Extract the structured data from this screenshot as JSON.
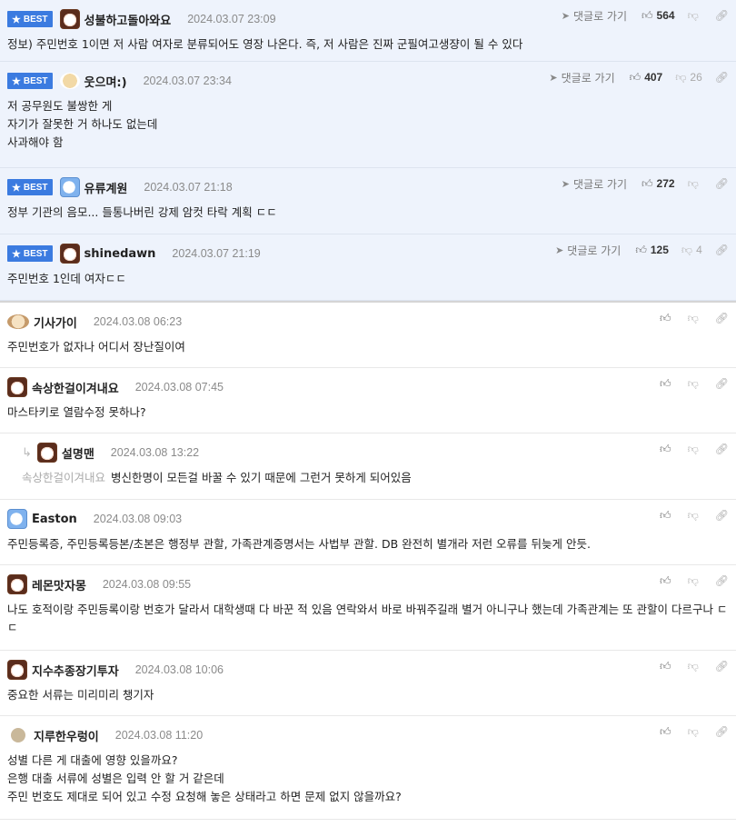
{
  "labels": {
    "best": "BEST",
    "reply_link": "댓글로 가기"
  },
  "comments": [
    {
      "nick": "성불하고돌아와요",
      "date": "2024.03.07 23:09",
      "up": "564",
      "down": "",
      "text": "정보) 주민번호 1이면 저 사람 여자로 분류되어도 영장 나온다. 즉, 저 사람은 진짜 군필여고생쟝이 될 수 있다"
    },
    {
      "nick": "웃으며:)",
      "date": "2024.03.07 23:34",
      "up": "407",
      "down": "26",
      "text": "저 공무원도 불쌍한 게\n자기가 잘못한 거 하나도 없는데\n사과해야 함"
    },
    {
      "nick": "유류계원",
      "date": "2024.03.07 21:18",
      "up": "272",
      "down": "",
      "text": "정부 기관의 음모... 들통나버린 강제 암컷 타락 계획 ㄷㄷ"
    },
    {
      "nick": "shinedawn",
      "date": "2024.03.07 21:19",
      "up": "125",
      "down": "4",
      "text": "주민번호 1인데 여자ㄷㄷ"
    },
    {
      "nick": "기사가이",
      "date": "2024.03.08 06:23",
      "text": "주민번호가 없자나 어디서 장난질이여"
    },
    {
      "nick": "속상한걸이겨내요",
      "date": "2024.03.08 07:45",
      "text": "마스타키로 열람수정 못하나?"
    },
    {
      "nick": "설명맨",
      "date": "2024.03.08 13:22",
      "mention": "속상한걸이겨내요",
      "text": "병신한명이 모든걸 바꿀 수 있기 때문에 그런거 못하게 되어있음"
    },
    {
      "nick": "Easton",
      "date": "2024.03.08 09:03",
      "text": "주민등록증, 주민등록등본/초본은 행정부 관할, 가족관계증명서는 사법부 관할. DB 완전히 별개라 저런 오류를 뒤늦게 안듯."
    },
    {
      "nick": "레몬맛자몽",
      "date": "2024.03.08 09:55",
      "text": "나도 호적이랑 주민등록이랑 번호가 달라서 대학생때 다 바꾼 적 있음 연락와서 바로 바꿔주길래 별거 아니구나 했는데 가족관계는 또 관할이 다르구나 ㄷㄷ"
    },
    {
      "nick": "지수추종장기투자",
      "date": "2024.03.08 10:06",
      "text": "중요한 서류는 미리미리 챙기자"
    },
    {
      "nick": "지루한우렁이",
      "date": "2024.03.08 11:20",
      "text": "성별 다른 게 대출에 영향 있을까요?\n은행 대출 서류에 성별은 입력 안 할 거 같은데\n주민 번호도 제대로 되어 있고 수정 요청해 놓은 상태라고 하면 문제 없지 않을까요?"
    }
  ]
}
